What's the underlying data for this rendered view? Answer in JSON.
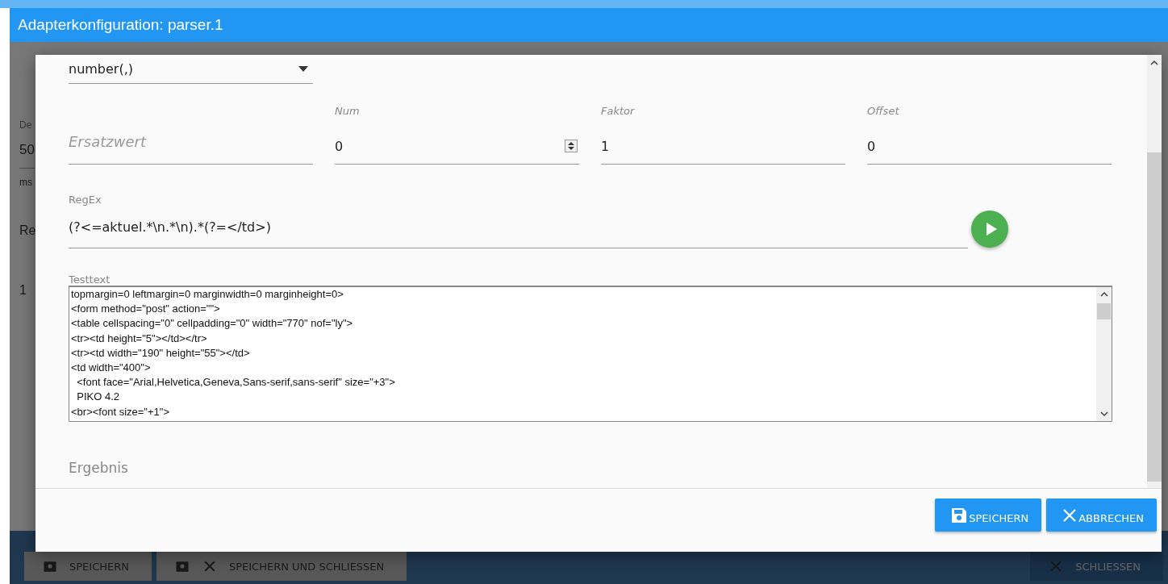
{
  "window": {
    "title": "Adapterkonfiguration: parser.1"
  },
  "background": {
    "texts": [
      {
        "kind": "label",
        "text": "De"
      },
      {
        "kind": "value",
        "text": "50"
      },
      {
        "kind": "unit",
        "text": "ms"
      },
      {
        "kind": "heading",
        "text": "Re"
      },
      {
        "kind": "cell",
        "text": "1"
      }
    ],
    "buttons": [
      {
        "kind": "save",
        "label": "SPEICHERN"
      },
      {
        "kind": "save-close",
        "label": "SPEICHERN UND SCHLIESSEN"
      },
      {
        "kind": "close",
        "label": "SCHLIESSEN"
      }
    ]
  },
  "dialog": {
    "type_select": {
      "value": "number(,)"
    },
    "fields": [
      {
        "kind": "placeholder",
        "placeholder": "Ersatzwert"
      },
      {
        "kind": "number",
        "label": "Num",
        "value": "0"
      },
      {
        "kind": "text",
        "label": "Faktor",
        "value": "1"
      },
      {
        "kind": "text",
        "label": "Offset",
        "value": "0"
      }
    ],
    "regex": {
      "label": "RegEx",
      "value": "(?<=aktuel.*\\n.*\\n).*(?=</td>)"
    },
    "testtext": {
      "label": "Testtext",
      "value": "topmargin=0 leftmargin=0 marginwidth=0 marginheight=0>\n<form method=\"post\" action=\"\">\n<table cellspacing=\"0\" cellpadding=\"0\" width=\"770\" nof=\"ly\">\n<tr><td height=\"5\"></td></tr>\n<tr><td width=\"190\" height=\"55\"></td>\n<td width=\"400\">\n  <font face=\"Arial,Helvetica,Geneva,Sans-serif,sans-serif\" size=\"+3\">\n  PIKO 4.2\n<br><font size=\"+1\">"
    },
    "result": {
      "placeholder": "Ergebnis"
    },
    "buttons": [
      {
        "kind": "save",
        "label": "SPEICHERN"
      },
      {
        "kind": "cancel",
        "label": "ABBRECHEN"
      }
    ]
  }
}
